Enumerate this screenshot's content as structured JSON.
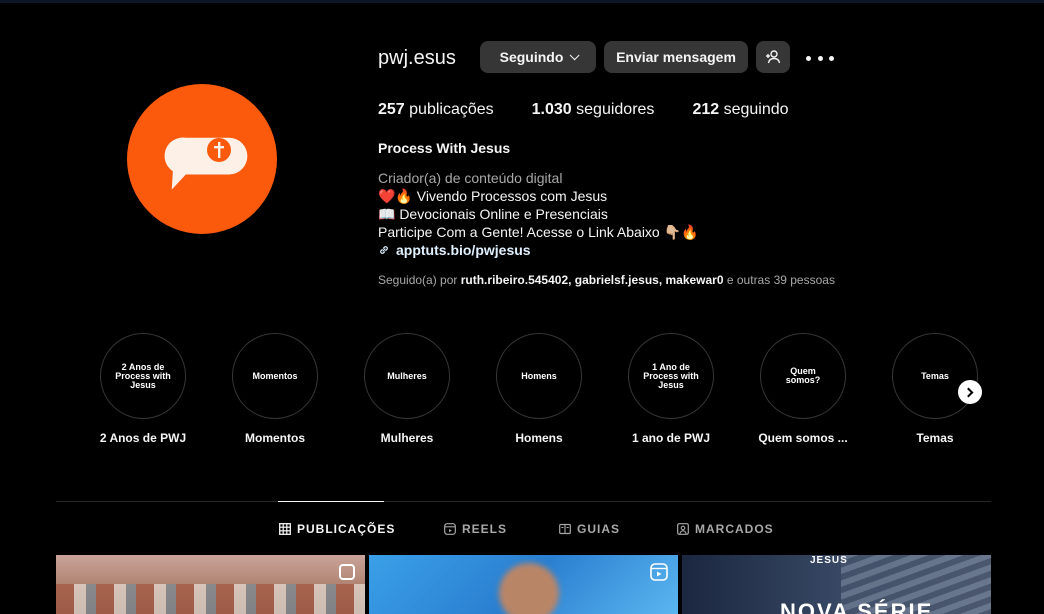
{
  "profile": {
    "username": "pwj.esus",
    "following_button": "Seguindo",
    "message_button": "Enviar mensagem",
    "stats": {
      "posts_count": "257",
      "posts_label": "publicações",
      "followers_count": "1.030",
      "followers_label": "seguidores",
      "following_count": "212",
      "following_label": "seguindo"
    },
    "full_name": "Process With Jesus",
    "category": "Criador(a) de conteúdo digital",
    "bio_lines": [
      "❤️🔥 Vivendo Processos com Jesus",
      "📖 Devocionais Online e Presenciais",
      "Participe Com a Gente! Acesse o Link Abaixo 👇🏼🔥"
    ],
    "link": "apptuts.bio/pwjesus",
    "followed_by_prefix": "Seguido(a) por",
    "followed_by_users": "ruth.ribeiro.545402, gabrielsf.jesus, makewar0",
    "followed_by_suffix": "e outras 39 pessoas",
    "accent_color": "#fb5a0d"
  },
  "highlights": [
    {
      "cover_text": "2 Anos de Process with Jesus",
      "label": "2 Anos de PWJ"
    },
    {
      "cover_text": "Momentos",
      "label": "Momentos"
    },
    {
      "cover_text": "Mulheres",
      "label": "Mulheres"
    },
    {
      "cover_text": "Homens",
      "label": "Homens"
    },
    {
      "cover_text": "1 Ano de Process with Jesus",
      "label": "1 ano de PWJ"
    },
    {
      "cover_text": "Quem somos?",
      "label": "Quem somos ..."
    },
    {
      "cover_text": "Temas",
      "label": "Temas"
    }
  ],
  "tabs": [
    {
      "label": "PUBLICAÇÕES",
      "icon": "grid-icon",
      "active": true
    },
    {
      "label": "REELS",
      "icon": "reels-icon",
      "active": false
    },
    {
      "label": "GUIAS",
      "icon": "guides-icon",
      "active": false
    },
    {
      "label": "MARCADOS",
      "icon": "tagged-icon",
      "active": false
    }
  ],
  "posts": [
    {
      "type": "carousel"
    },
    {
      "type": "reel"
    },
    {
      "type": "image",
      "text_top": "JESUS",
      "text_main": "NOVA SÉRIE"
    }
  ]
}
